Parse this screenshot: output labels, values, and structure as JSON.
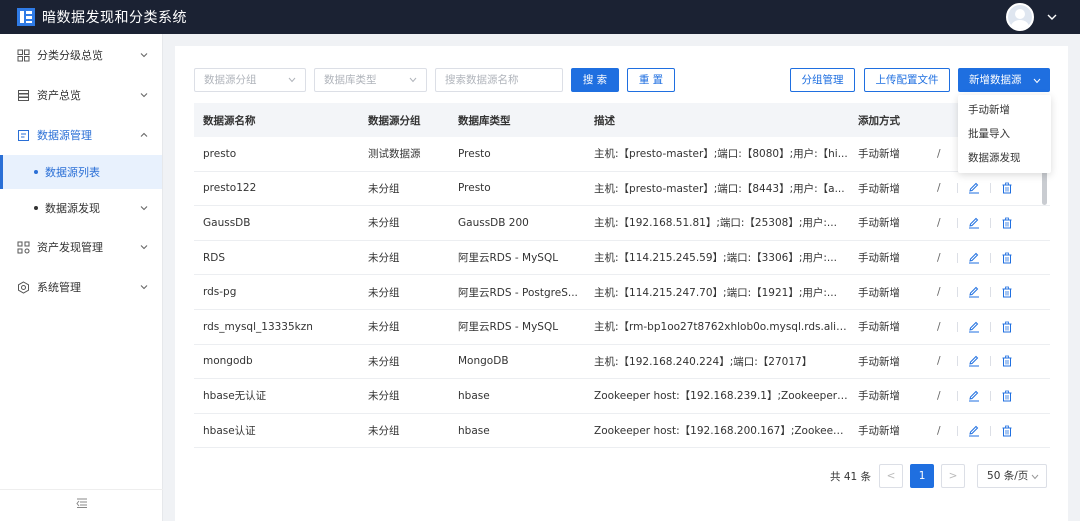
{
  "app": {
    "title": "暗数据发现和分类系统"
  },
  "sidebar": {
    "items": [
      {
        "label": "分类分级总览",
        "icon": "grid-icon"
      },
      {
        "label": "资产总览",
        "icon": "database-icon"
      },
      {
        "label": "数据源管理",
        "icon": "document-icon"
      },
      {
        "label": "资产发现管理",
        "icon": "apps-icon"
      },
      {
        "label": "系统管理",
        "icon": "settings-icon"
      }
    ],
    "subitems": [
      {
        "label": "数据源列表"
      },
      {
        "label": "数据源发现"
      }
    ]
  },
  "toolbar": {
    "group_placeholder": "数据源分组",
    "dbtype_placeholder": "数据库类型",
    "search_placeholder": "搜索数据源名称",
    "search_label": "搜 索",
    "reset_label": "重 置",
    "group_mgmt_label": "分组管理",
    "upload_config_label": "上传配置文件",
    "add_source_label": "新增数据源"
  },
  "dropdown": {
    "items": [
      "手动新增",
      "批量导入",
      "数据源发现"
    ]
  },
  "table": {
    "headers": [
      "数据源名称",
      "数据源分组",
      "数据库类型",
      "描述",
      "添加方式"
    ],
    "rows": [
      {
        "name": "presto",
        "group": "测试数据源",
        "type": "Presto",
        "desc": "主机:【presto-master】;端口:【8080】;用户:【hi...",
        "method": "手动新增"
      },
      {
        "name": "presto122",
        "group": "未分组",
        "type": "Presto",
        "desc": "主机:【presto-master】;端口:【8443】;用户:【a...",
        "method": "手动新增"
      },
      {
        "name": "GaussDB",
        "group": "未分组",
        "type": "GaussDB 200",
        "desc": "主机:【192.168.51.81】;端口:【25308】;用户:...",
        "method": "手动新增"
      },
      {
        "name": "RDS",
        "group": "未分组",
        "type": "阿里云RDS - MySQL",
        "desc": "主机:【114.215.245.59】;端口:【3306】;用户:...",
        "method": "手动新增"
      },
      {
        "name": "rds-pg",
        "group": "未分组",
        "type": "阿里云RDS - PostgreS...",
        "desc": "主机:【114.215.247.70】;端口:【1921】;用户:...",
        "method": "手动新增"
      },
      {
        "name": "rds_mysql_13335kzn",
        "group": "未分组",
        "type": "阿里云RDS - MySQL",
        "desc": "主机:【rm-bp1oo27t8762xhlob0o.mysql.rds.aliy...",
        "method": "手动新增"
      },
      {
        "name": "mongodb",
        "group": "未分组",
        "type": "MongoDB",
        "desc": "主机:【192.168.240.224】;端口:【27017】",
        "method": "手动新增"
      },
      {
        "name": "hbase无认证",
        "group": "未分组",
        "type": "hbase",
        "desc": "Zookeeper host:【192.168.239.1】;Zookeeper ...",
        "method": "手动新增"
      },
      {
        "name": "hbase认证",
        "group": "未分组",
        "type": "hbase",
        "desc": "Zookeeper host:【192.168.200.167】;Zookeep...",
        "method": "手动新增"
      }
    ],
    "op_slash": "/"
  },
  "pager": {
    "total": "共 41 条",
    "prev": "<",
    "current": "1",
    "next": ">",
    "page_size": "50 条/页"
  },
  "colors": {
    "primary": "#1f6fe0",
    "topbar": "#1b2233"
  }
}
